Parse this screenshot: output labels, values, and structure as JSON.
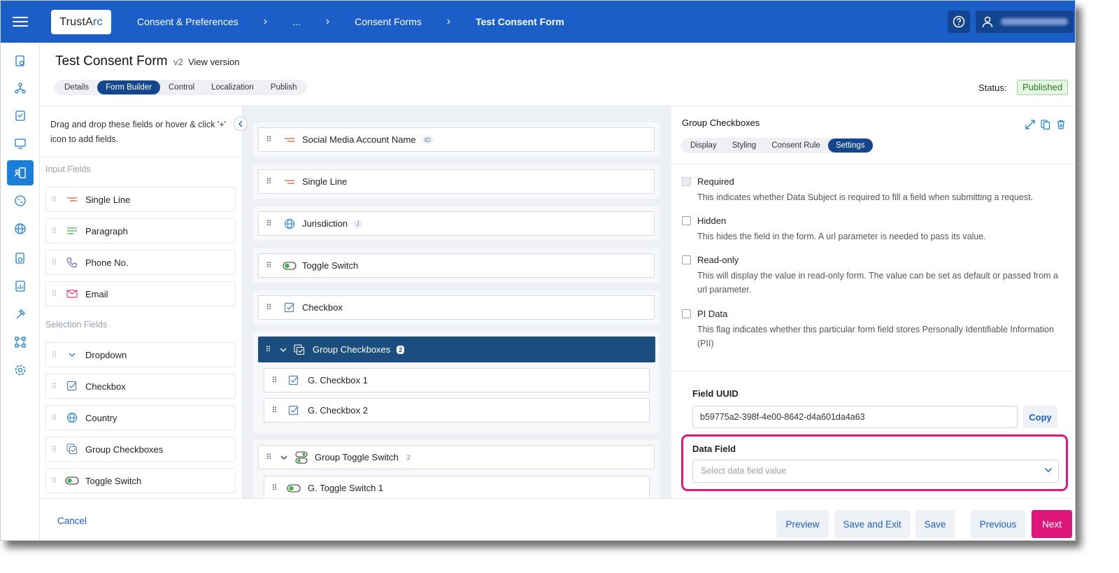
{
  "header": {
    "logo_text_a": "TrustA",
    "logo_text_b": "rc",
    "breadcrumbs": [
      "Consent & Preferences",
      "...",
      "Consent Forms",
      "Test Consent Form"
    ],
    "help_icon": "help-circle-icon",
    "user_icon": "user-icon"
  },
  "page": {
    "title": "Test Consent Form",
    "version": "v2",
    "view_version": "View version",
    "tabs": [
      "Details",
      "Form Builder",
      "Control",
      "Localization",
      "Publish"
    ],
    "selected_tab": "Form Builder",
    "status_label": "Status:",
    "status_value": "Published"
  },
  "palette": {
    "hint": "Drag and drop these fields or hover & click '+' icon to add fields.",
    "input_section": "Input Fields",
    "input_items": [
      {
        "label": "Single Line",
        "icon": "single-line-icon"
      },
      {
        "label": "Paragraph",
        "icon": "paragraph-icon"
      },
      {
        "label": "Phone No.",
        "icon": "phone-icon"
      },
      {
        "label": "Email",
        "icon": "email-icon"
      }
    ],
    "selection_section": "Selection Fields",
    "selection_items": [
      {
        "label": "Dropdown",
        "icon": "dropdown-icon"
      },
      {
        "label": "Checkbox",
        "icon": "checkbox-icon"
      },
      {
        "label": "Country",
        "icon": "globe-icon"
      },
      {
        "label": "Group Checkboxes",
        "icon": "group-checkbox-icon"
      },
      {
        "label": "Toggle Switch",
        "icon": "toggle-icon"
      }
    ]
  },
  "canvas": {
    "rows": [
      {
        "label": "Social Media Account Name",
        "badge": "ID",
        "icon": "single-line-icon"
      },
      {
        "label": "Single Line",
        "badge": "",
        "icon": "single-line-icon"
      },
      {
        "label": "Jurisdiction",
        "badge": "J",
        "icon": "globe-icon"
      },
      {
        "label": "Toggle Switch",
        "badge": "",
        "icon": "toggle-icon"
      },
      {
        "label": "Checkbox",
        "badge": "",
        "icon": "checkbox-icon"
      }
    ],
    "group_checkboxes": {
      "label": "Group Checkboxes",
      "count": "2",
      "children": [
        "G. Checkbox 1",
        "G. Checkbox 2"
      ]
    },
    "group_toggle": {
      "label": "Group Toggle Switch",
      "count": "2",
      "children": [
        "G. Toggle Switch 1"
      ]
    }
  },
  "settings": {
    "title": "Group Checkboxes",
    "tabs": [
      "Display",
      "Styling",
      "Consent Rule",
      "Settings"
    ],
    "selected_tab": "Settings",
    "options": [
      {
        "name": "Required",
        "desc": "This indicates whether Data Subject is required to fill a field when submitting a request.",
        "disabled": true
      },
      {
        "name": "Hidden",
        "desc": "This hides the field in the form. A url parameter is needed to pass its value.",
        "disabled": false
      },
      {
        "name": "Read-only",
        "desc": "This will display the value in read-only form. The value can be set as default or passed from a url parameter.",
        "disabled": false
      },
      {
        "name": "PI Data",
        "desc": "This flag indicates whether this particular form field stores Personally Identifiable Information (PII)",
        "disabled": false
      }
    ],
    "uuid_label": "Field UUID",
    "uuid_value": "b59775a2-398f-4e00-8642-d4a601da4a63",
    "copy_label": "Copy",
    "data_field_label": "Data Field",
    "data_field_placeholder": "Select data field value"
  },
  "footer": {
    "cancel": "Cancel",
    "preview": "Preview",
    "save_exit": "Save and Exit",
    "save": "Save",
    "previous": "Previous",
    "next": "Next"
  },
  "colors": {
    "header": "#1b5ec8",
    "primary_btn": "#e0177a",
    "selected_row": "#1b4e7e",
    "highlight": "#e01876"
  }
}
